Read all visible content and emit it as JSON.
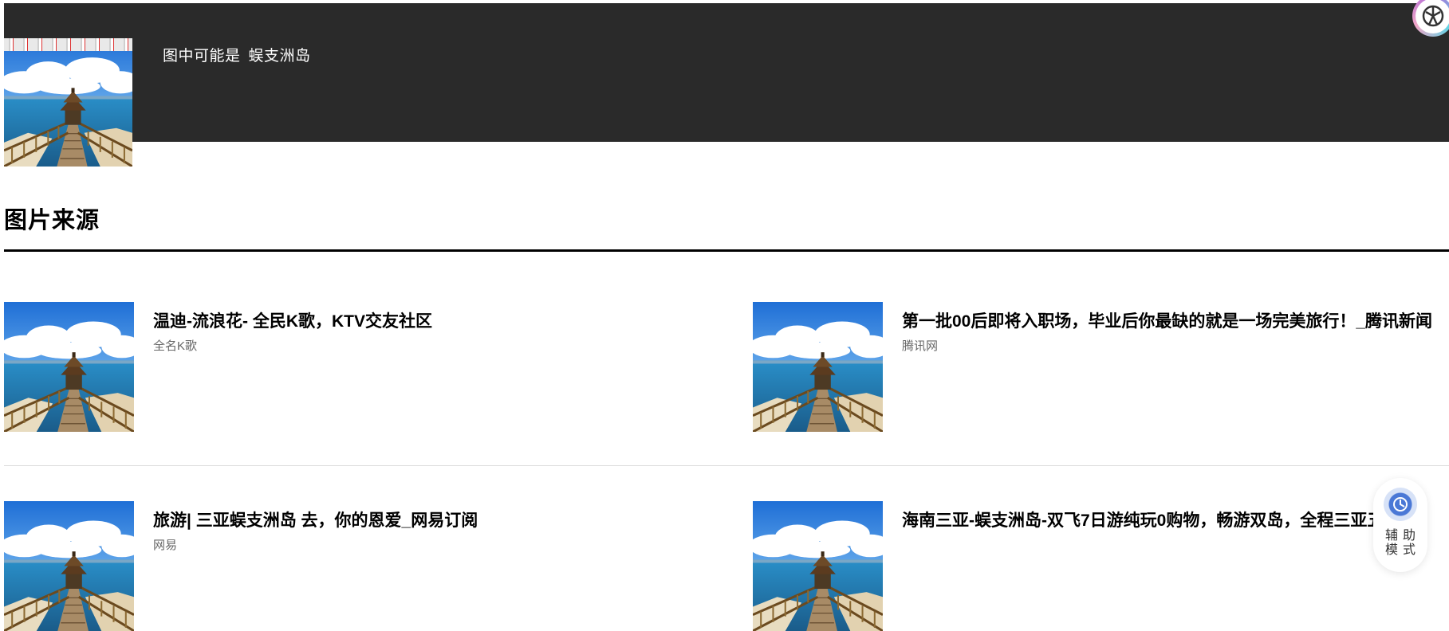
{
  "header": {
    "caption_prefix": "图中可能是",
    "caption_entity": "蜈支洲岛"
  },
  "section": {
    "title": "图片来源"
  },
  "results": [
    {
      "title": "温迪-流浪花- 全民K歌，KTV交友社区",
      "source": "全名K歌"
    },
    {
      "title": "第一批00后即将入职场，毕业后你最缺的就是一场完美旅行！_腾讯新闻",
      "source": "腾讯网"
    },
    {
      "title": "旅游| 三亚蜈支洲岛 去，你的恩爱_网易订阅",
      "source": "网易"
    },
    {
      "title": "海南三亚-蜈支洲岛-双飞7日游纯玩0购物，畅游双岛，全程三亚五星海",
      "source": ""
    }
  ],
  "assist_button": {
    "label": "辅助模式"
  },
  "icons": {
    "corner_logo": "app-logo-icon",
    "assist": "accessibility-icon"
  },
  "colors": {
    "header_bg": "#2a2a2a",
    "text": "#000000",
    "source_text": "#666666",
    "accent": "#4a78d6"
  }
}
